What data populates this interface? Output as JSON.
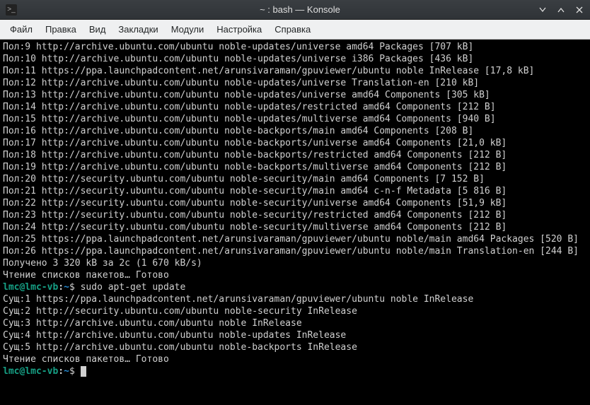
{
  "titlebar": {
    "title": "~ : bash — Konsole"
  },
  "menu": [
    "Файл",
    "Правка",
    "Вид",
    "Закладки",
    "Модули",
    "Настройка",
    "Справка"
  ],
  "output1": [
    "Пол:9 http://archive.ubuntu.com/ubuntu noble-updates/universe amd64 Packages [707 kB]",
    "Пол:10 http://archive.ubuntu.com/ubuntu noble-updates/universe i386 Packages [436 kB]",
    "Пол:11 https://ppa.launchpadcontent.net/arunsivaraman/gpuviewer/ubuntu noble InRelease [17,8 kB]",
    "Пол:12 http://archive.ubuntu.com/ubuntu noble-updates/universe Translation-en [210 kB]",
    "Пол:13 http://archive.ubuntu.com/ubuntu noble-updates/universe amd64 Components [305 kB]",
    "Пол:14 http://archive.ubuntu.com/ubuntu noble-updates/restricted amd64 Components [212 B]",
    "Пол:15 http://archive.ubuntu.com/ubuntu noble-updates/multiverse amd64 Components [940 B]",
    "Пол:16 http://archive.ubuntu.com/ubuntu noble-backports/main amd64 Components [208 B]",
    "Пол:17 http://archive.ubuntu.com/ubuntu noble-backports/universe amd64 Components [21,0 kB]",
    "Пол:18 http://archive.ubuntu.com/ubuntu noble-backports/restricted amd64 Components [212 B]",
    "Пол:19 http://archive.ubuntu.com/ubuntu noble-backports/multiverse amd64 Components [212 B]",
    "Пол:20 http://security.ubuntu.com/ubuntu noble-security/main amd64 Components [7 152 B]",
    "Пол:21 http://security.ubuntu.com/ubuntu noble-security/main amd64 c-n-f Metadata [5 816 B]",
    "Пол:22 http://security.ubuntu.com/ubuntu noble-security/universe amd64 Components [51,9 kB]",
    "Пол:23 http://security.ubuntu.com/ubuntu noble-security/restricted amd64 Components [212 B]",
    "Пол:24 http://security.ubuntu.com/ubuntu noble-security/multiverse amd64 Components [212 B]",
    "Пол:25 https://ppa.launchpadcontent.net/arunsivaraman/gpuviewer/ubuntu noble/main amd64 Packages [520 B]",
    "Пол:26 https://ppa.launchpadcontent.net/arunsivaraman/gpuviewer/ubuntu noble/main Translation-en [244 B]",
    "Получено 3 320 kB за 2с (1 670 kB/s)",
    "Чтение списков пакетов… Готово"
  ],
  "prompt1": {
    "userhost": "lmc@lmc-vb",
    "sep": ":",
    "path": "~",
    "sym": "$ ",
    "cmd": "sudo apt-get update"
  },
  "output2": [
    "Сущ:1 https://ppa.launchpadcontent.net/arunsivaraman/gpuviewer/ubuntu noble InRelease",
    "Сущ:2 http://security.ubuntu.com/ubuntu noble-security InRelease",
    "Сущ:3 http://archive.ubuntu.com/ubuntu noble InRelease",
    "Сущ:4 http://archive.ubuntu.com/ubuntu noble-updates InRelease",
    "Сущ:5 http://archive.ubuntu.com/ubuntu noble-backports InRelease",
    "Чтение списков пакетов… Готово"
  ],
  "prompt2": {
    "userhost": "lmc@lmc-vb",
    "sep": ":",
    "path": "~",
    "sym": "$ ",
    "cmd": ""
  }
}
